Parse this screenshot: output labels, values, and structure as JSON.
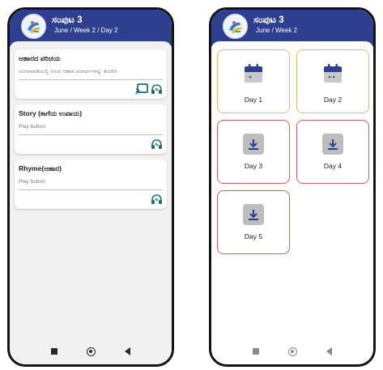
{
  "left_screen": {
    "appbar": {
      "title": "ಸಂಪುಟ 3",
      "subtitle": "June / Week 2 / Day 2"
    },
    "cards": [
      {
        "title": "ಆಹಾರದ ಪರಿಚಯ",
        "subtitle": "ಅಂಗನವಾಡಿಯಲ್ಲಿ ಸಿಗುವ ಆಹಾರ ಪದಾರ್ಥಗಳನ್ನು ತೋರಿಸಿ",
        "icons": [
          "cast-icon",
          "headphones-icon"
        ]
      },
      {
        "title": "Story (ಕಾಗೆಯ ಉಪಾಯ)",
        "subtitle": "Play button",
        "icons": [
          "headphones-icon"
        ]
      },
      {
        "title": "Rhyme(ಆಹಾರ)",
        "subtitle": "Play button",
        "icons": [
          "headphones-icon"
        ]
      }
    ]
  },
  "right_screen": {
    "appbar": {
      "title": "ಸಂಪುಟ 3",
      "subtitle": "June / Week 2"
    },
    "days": [
      {
        "label": "Day 1",
        "state": "available",
        "icon": "calendar-icon"
      },
      {
        "label": "Day 2",
        "state": "available",
        "icon": "calendar-icon"
      },
      {
        "label": "Day 3",
        "state": "download",
        "icon": "download-icon"
      },
      {
        "label": "Day 4",
        "state": "download",
        "icon": "download-icon"
      },
      {
        "label": "Day 5",
        "state": "download",
        "icon": "download-icon"
      }
    ]
  },
  "navbar": {
    "icons": [
      "recents-square-icon",
      "home-circle-icon",
      "back-triangle-icon"
    ]
  },
  "colors": {
    "appbar": "#2f3f8f",
    "available_border": "#e2be6a",
    "download_border": "#c9605a",
    "accent_icon": "#1f6f73",
    "background": "#f1f1f1"
  }
}
